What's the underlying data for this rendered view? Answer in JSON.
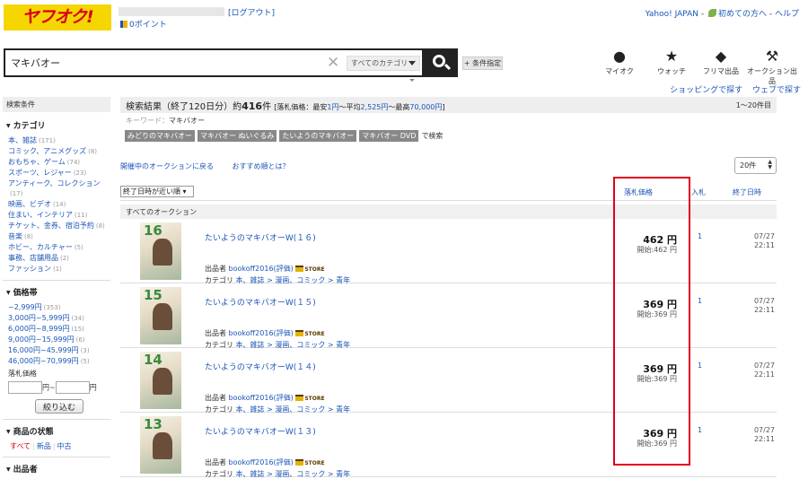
{
  "header": {
    "logo_text": "ヤフオク!",
    "logout": "[ログアウト]",
    "points": "0ポイント",
    "yahoo_japan": "Yahoo! JAPAN",
    "first_time": "初めての方へ",
    "help": "ヘルプ",
    "separator": "-"
  },
  "search": {
    "query": "マキバオー",
    "category_select": "すべてのカテゴリ",
    "condition_button": "+ 条件指定"
  },
  "header_icons": [
    {
      "label": "マイオク",
      "icon": "person-icon"
    },
    {
      "label": "ウォッチ",
      "icon": "star-icon"
    },
    {
      "label": "フリマ出品",
      "icon": "tag-icon"
    },
    {
      "label": "オークション出品",
      "icon": "gavel-icon"
    }
  ],
  "shop_links": {
    "shopping": "ショッピングで探す",
    "web": "ウェブで探す"
  },
  "sidebar": {
    "heading": "検索条件",
    "category_title": "カテゴリ",
    "categories": [
      {
        "label": "本、雑誌",
        "count": "(171)"
      },
      {
        "label": "コミック、アニメグッズ",
        "count": "(8)"
      },
      {
        "label": "おもちゃ、ゲーム",
        "count": "(74)"
      },
      {
        "label": "スポーツ、レジャー",
        "count": "(23)"
      },
      {
        "label": "アンティーク、コレクション",
        "count": "(17)"
      },
      {
        "label": "映画、ビデオ",
        "count": "(14)"
      },
      {
        "label": "住まい、インテリア",
        "count": "(11)"
      },
      {
        "label": "チケット、金券、宿泊予約",
        "count": "(8)"
      },
      {
        "label": "音楽",
        "count": "(8)"
      },
      {
        "label": "ホビー、カルチャー",
        "count": "(5)"
      },
      {
        "label": "事務、店舗用品",
        "count": "(2)"
      },
      {
        "label": "ファッション",
        "count": "(1)"
      }
    ],
    "price_title": "価格帯",
    "price_ranges": [
      {
        "label": "~2,999円",
        "count": "(353)"
      },
      {
        "label": "3,000円~5,999円",
        "count": "(34)"
      },
      {
        "label": "6,000円~8,999円",
        "count": "(15)"
      },
      {
        "label": "9,000円~15,999円",
        "count": "(6)"
      },
      {
        "label": "16,000円~45,999円",
        "count": "(3)"
      },
      {
        "label": "46,000円~70,999円",
        "count": "(5)"
      }
    ],
    "price_label": "落札価格",
    "yen_tilde": "円~",
    "yen": "円",
    "refine_button": "絞り込む",
    "condition_title": "商品の状態",
    "cond_all": "すべて",
    "cond_new": "新品",
    "cond_used": "中古",
    "seller_title": "出品者"
  },
  "summary": {
    "prefix": "検索結果（終了120日分）約",
    "count": "416",
    "suffix": "件",
    "price_info": "[落札価格：最安",
    "min": "1円",
    "avg_label": "～平均",
    "avg": "2,525円",
    "max_label": "～最高",
    "max": "70,000円",
    "close": "]",
    "range": "1～20件目"
  },
  "keyword": {
    "label": "キーワード：",
    "value": "マキバオー"
  },
  "related": {
    "tags": [
      "みどりのマキバオー",
      "マキバオー ぬいぐるみ",
      "たいようのマキバオー",
      "マキバオー DVD"
    ],
    "suffix": "で検索"
  },
  "links": {
    "back": "開催中のオークションに戻る",
    "recommend": "おすすめ順とは？"
  },
  "per_page": "20件",
  "sort": "終了日時が近い順",
  "columns": {
    "price": "落札価格",
    "bids": "入札",
    "end": "終了日時"
  },
  "all_auctions": "すべてのオークション",
  "rows": [
    {
      "vol": "16",
      "title": "たいようのマキバオーW(１６)",
      "price": "462 円",
      "start": "開始:462 円",
      "bids": "1",
      "date": "07/27",
      "time": "22:11",
      "seller_prefix": "出品者",
      "seller": "bookoff2016",
      "rating": "(評価)",
      "store": "STORE",
      "cat_label": "カテゴリ",
      "cat": "本、雑誌 > 漫画、コミック > 青年"
    },
    {
      "vol": "15",
      "title": "たいようのマキバオーW(１５)",
      "price": "369 円",
      "start": "開始:369 円",
      "bids": "1",
      "date": "07/27",
      "time": "22:11",
      "seller_prefix": "出品者",
      "seller": "bookoff2016",
      "rating": "(評価)",
      "store": "STORE",
      "cat_label": "カテゴリ",
      "cat": "本、雑誌 > 漫画、コミック > 青年"
    },
    {
      "vol": "14",
      "title": "たいようのマキバオーW(１４)",
      "price": "369 円",
      "start": "開始:369 円",
      "bids": "1",
      "date": "07/27",
      "time": "22:11",
      "seller_prefix": "出品者",
      "seller": "bookoff2016",
      "rating": "(評価)",
      "store": "STORE",
      "cat_label": "カテゴリ",
      "cat": "本、雑誌 > 漫画、コミック > 青年"
    },
    {
      "vol": "13",
      "title": "たいようのマキバオーW(１３)",
      "price": "369 円",
      "start": "開始:369 円",
      "bids": "1",
      "date": "07/27",
      "time": "22:11",
      "seller_prefix": "出品者",
      "seller": "bookoff2016",
      "rating": "(評価)",
      "store": "STORE",
      "cat_label": "カテゴリ",
      "cat": "本、雑誌 > 漫画、コミック > 青年"
    }
  ],
  "colors": {
    "brand_yellow": "#f5d600",
    "brand_red": "#d6001c",
    "link": "#1a55b8",
    "highlight": "#e0001c"
  }
}
